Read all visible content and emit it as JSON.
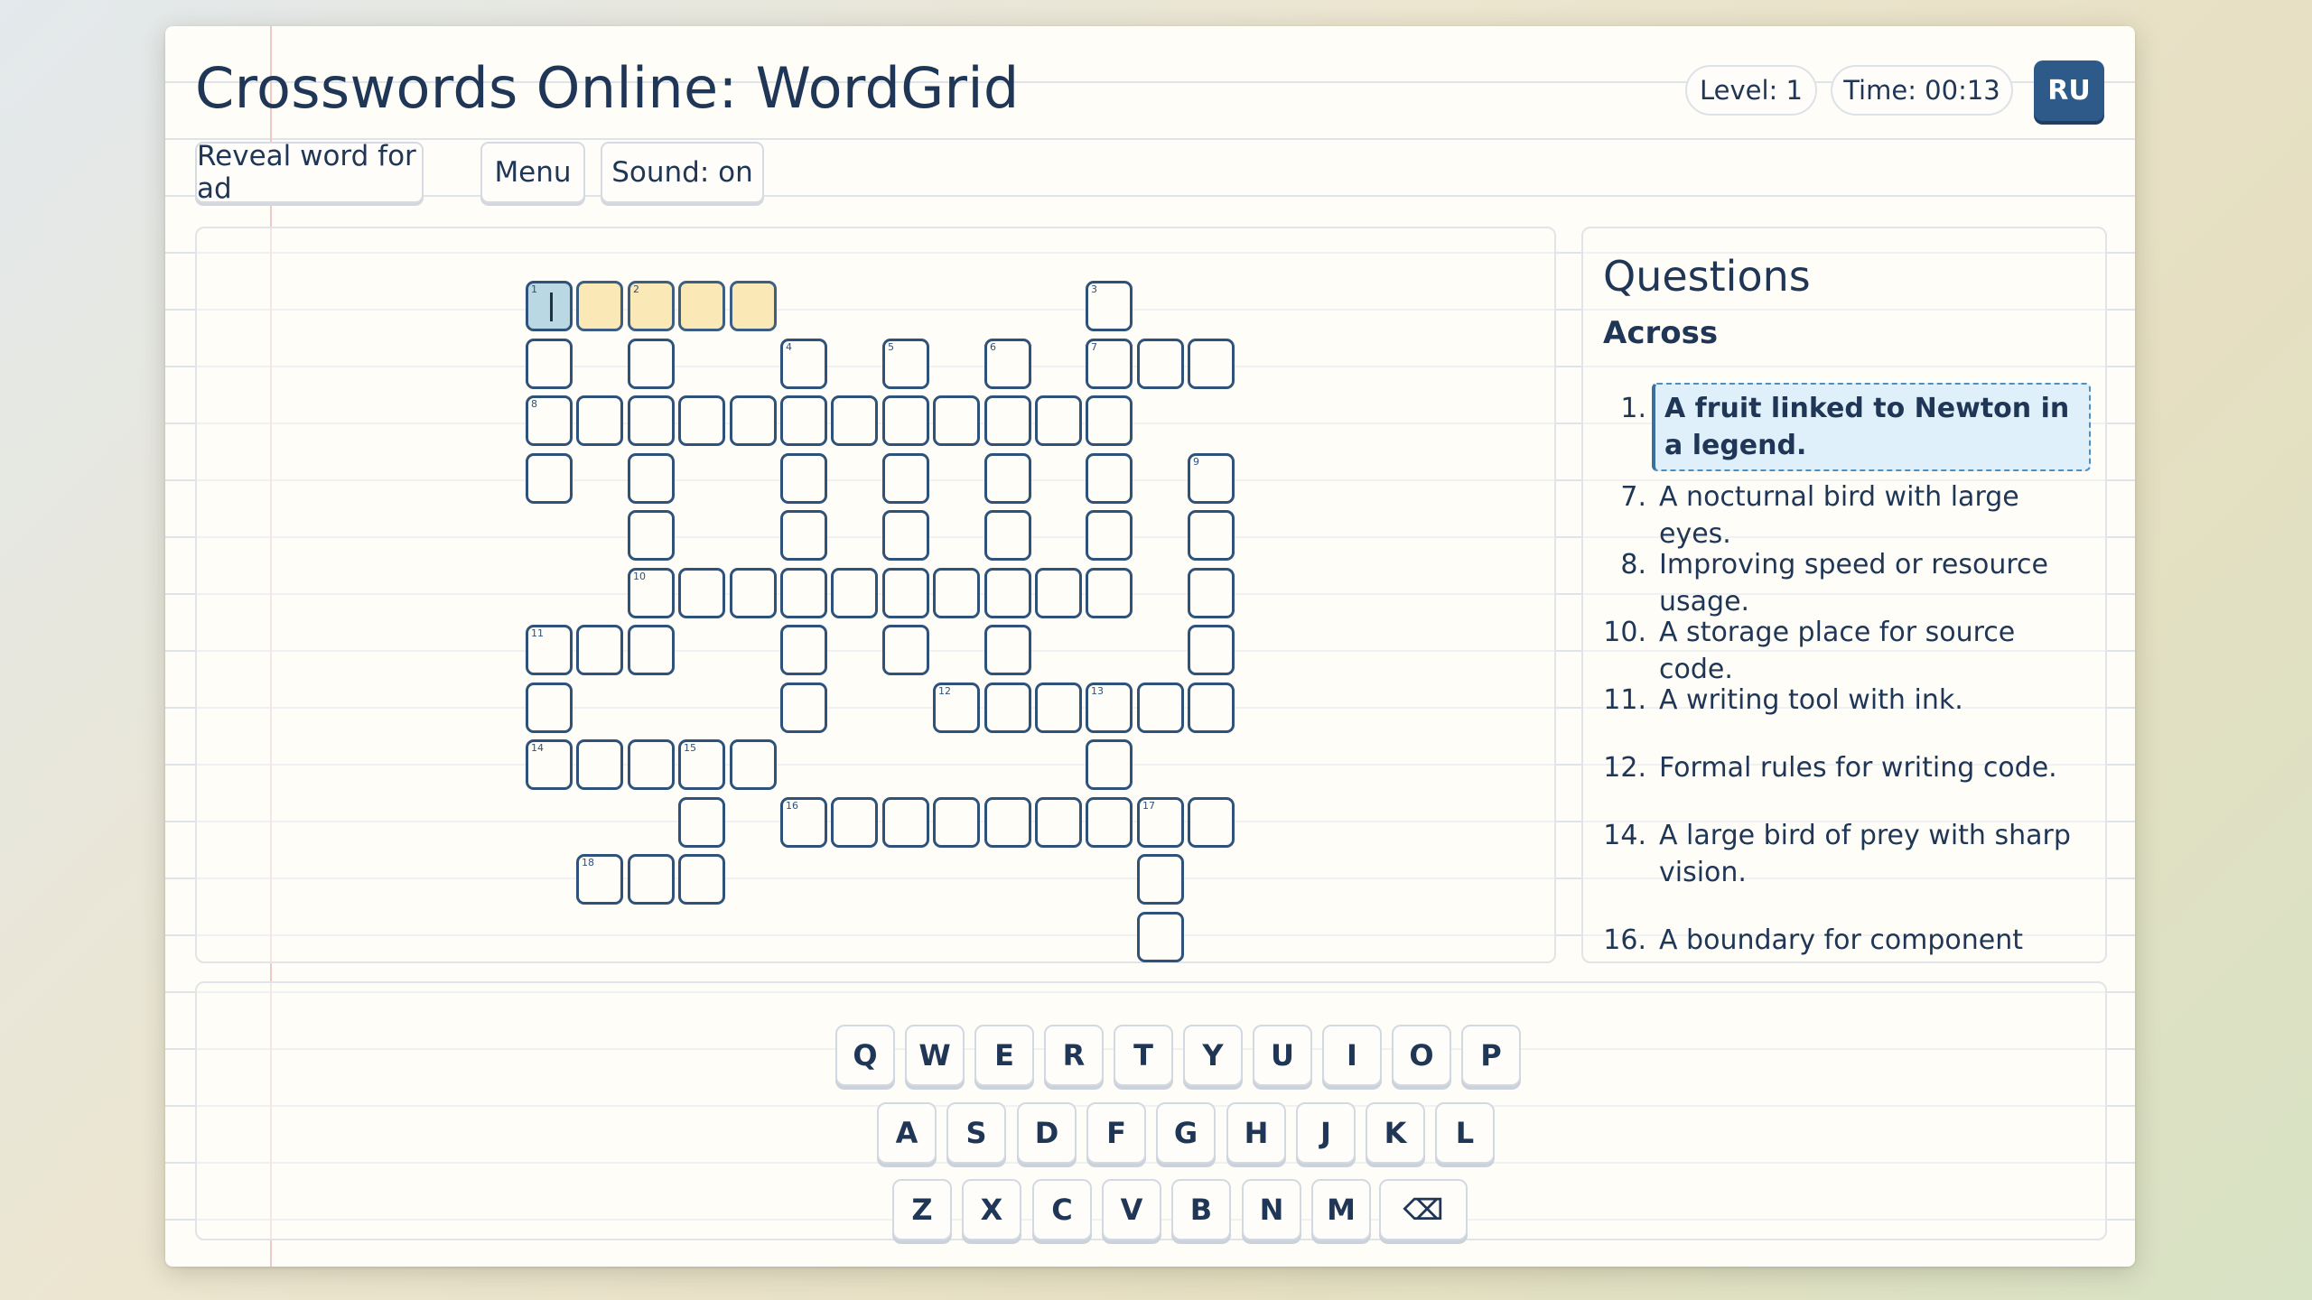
{
  "header": {
    "title": "Crosswords Online: WordGrid",
    "level": "Level: 1",
    "time": "Time: 00:13",
    "language": "RU"
  },
  "toolbar": {
    "reveal": "Reveal word for ad",
    "menu": "Menu",
    "sound": "Sound: on"
  },
  "questions": {
    "title": "Questions",
    "section": "Across",
    "clues": [
      {
        "num": "1.",
        "text": "A fruit linked to Newton in a legend."
      },
      {
        "num": "7.",
        "text": "A nocturnal bird with large eyes."
      },
      {
        "num": "8.",
        "text": "Improving speed or resource usage."
      },
      {
        "num": "10.",
        "text": "A storage place for source code."
      },
      {
        "num": "11.",
        "text": "A writing tool with ink."
      },
      {
        "num": "12.",
        "text": "Formal rules for writing code."
      },
      {
        "num": "14.",
        "text": "A large bird of prey with sharp vision."
      },
      {
        "num": "16.",
        "text": "A boundary for component"
      }
    ]
  },
  "keyboard": {
    "row1": [
      "Q",
      "W",
      "E",
      "R",
      "T",
      "Y",
      "U",
      "I",
      "O",
      "P"
    ],
    "row2": [
      "A",
      "S",
      "D",
      "F",
      "G",
      "H",
      "J",
      "K",
      "L"
    ],
    "row3": [
      "Z",
      "X",
      "C",
      "V",
      "B",
      "N",
      "M"
    ],
    "backspace": "⌫"
  },
  "colors": {
    "accent": "#2e5a8a",
    "cell_border": "#2e5279",
    "highlight": "#fae9b6",
    "current_cell": "#bad8e3"
  }
}
